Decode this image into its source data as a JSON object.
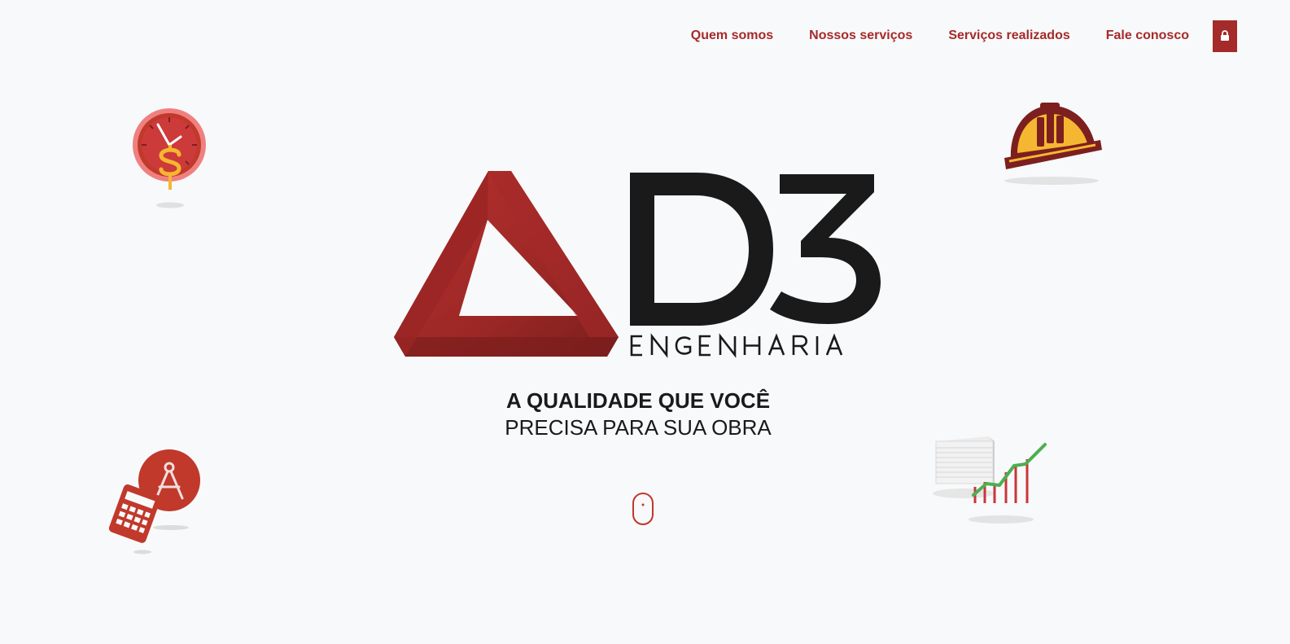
{
  "nav": {
    "items": [
      {
        "label": "Quem somos"
      },
      {
        "label": "Nossos serviços"
      },
      {
        "label": "Serviços realizados"
      },
      {
        "label": "Fale conosco"
      }
    ],
    "login_icon": "lock-icon"
  },
  "logo": {
    "mark": "D3",
    "subtitle": "ENGENHARIA"
  },
  "hero": {
    "tagline_line1": "A QUALIDADE QUE VOCÊ",
    "tagline_line2": "PRECISA PARA SUA OBRA",
    "scroll_icon": "mouse-scroll-icon"
  },
  "decorations": [
    "clock-dollar-icon",
    "hard-hat-icon",
    "calculator-compass-icon",
    "growth-chart-icon"
  ],
  "colors": {
    "brand_red": "#a52a2a",
    "background": "#f8f9fa",
    "text_dark": "#1a1a1a",
    "accent_yellow": "#f5b731",
    "accent_green": "#4caf50"
  }
}
